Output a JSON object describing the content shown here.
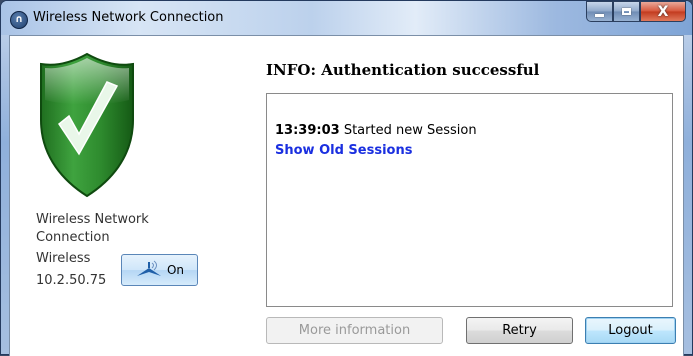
{
  "window": {
    "title": "Wireless Network Connection",
    "icon": "lock-icon",
    "caption": {
      "minimize": "minimize-icon",
      "maximize": "maximize-icon",
      "close": "X"
    }
  },
  "status": {
    "shield_icon": "check-shield-icon",
    "shield_color": "#2e8b2e",
    "connection_name": "Wireless Network Connection",
    "connection_type": "Wireless",
    "ip_address": "10.2.50.75",
    "toggle_label": "On",
    "toggle_icon": "wireless-icon"
  },
  "main": {
    "info_title": "INFO: Authentication successful",
    "log": [
      {
        "time": "13:39:03",
        "message": "Started new Session"
      }
    ],
    "show_old_sessions": "Show Old Sessions"
  },
  "buttons": {
    "more_information": "More information",
    "retry": "Retry",
    "logout": "Logout"
  }
}
